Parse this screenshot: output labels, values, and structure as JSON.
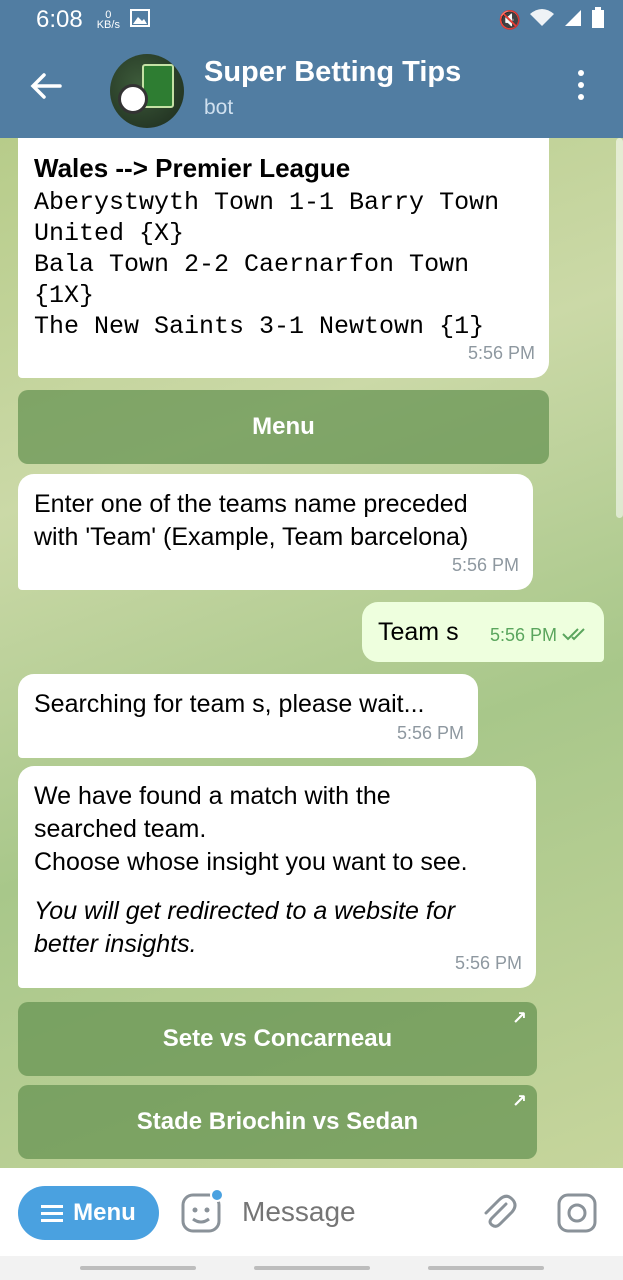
{
  "status_bar": {
    "time": "6:08",
    "speed_value": "0",
    "speed_unit": "KB/s",
    "image_icon": "image-icon",
    "mute_icon": "mute-icon",
    "wifi_icon": "wifi-icon",
    "signal_icon": "signal-icon",
    "battery_icon": "battery-icon"
  },
  "header": {
    "title": "Super Betting Tips",
    "subtitle": "bot",
    "back_icon": "back-arrow-icon",
    "more_icon": "more-vert-icon"
  },
  "messages": [
    {
      "direction": "in",
      "league": "Wales  -->  Premier League",
      "lines": [
        "Aberystwyth Town 1-1 Barry Town",
        "United {X}",
        "Bala Town 2-2 Caernarfon Town",
        "{1X}",
        "The New Saints 3-1 Newtown {1}"
      ],
      "time": "5:56 PM"
    },
    {
      "direction": "in",
      "text": "Enter one of the teams name preceded with 'Team' (Example, Team barcelona)",
      "time": "5:56 PM"
    },
    {
      "direction": "out",
      "text": "Team s",
      "time": "5:56 PM",
      "read": true
    },
    {
      "direction": "in",
      "text": "Searching for team s, please wait...",
      "time": "5:56 PM"
    },
    {
      "direction": "in",
      "text_lines": [
        "We have found a match with the",
        "searched team.",
        "Choose whose insight you want to see."
      ],
      "italic": "You will get redirected to a website for better insights.",
      "time": "5:56 PM"
    }
  ],
  "keyboard": {
    "menu_button": "Menu",
    "inline_buttons": [
      "Sete vs Concarneau",
      "Stade Briochin vs Sedan"
    ]
  },
  "composer": {
    "menu_label": "Menu",
    "placeholder": "Message",
    "sticker_icon": "sticker-icon",
    "attach_icon": "paperclip-icon",
    "camera_icon": "camera-icon"
  },
  "colors": {
    "header": "#517da2",
    "outgoing_bubble": "#eeffde",
    "menu_button": "#4aa1e0",
    "keyboard_button": "#6f9752"
  }
}
